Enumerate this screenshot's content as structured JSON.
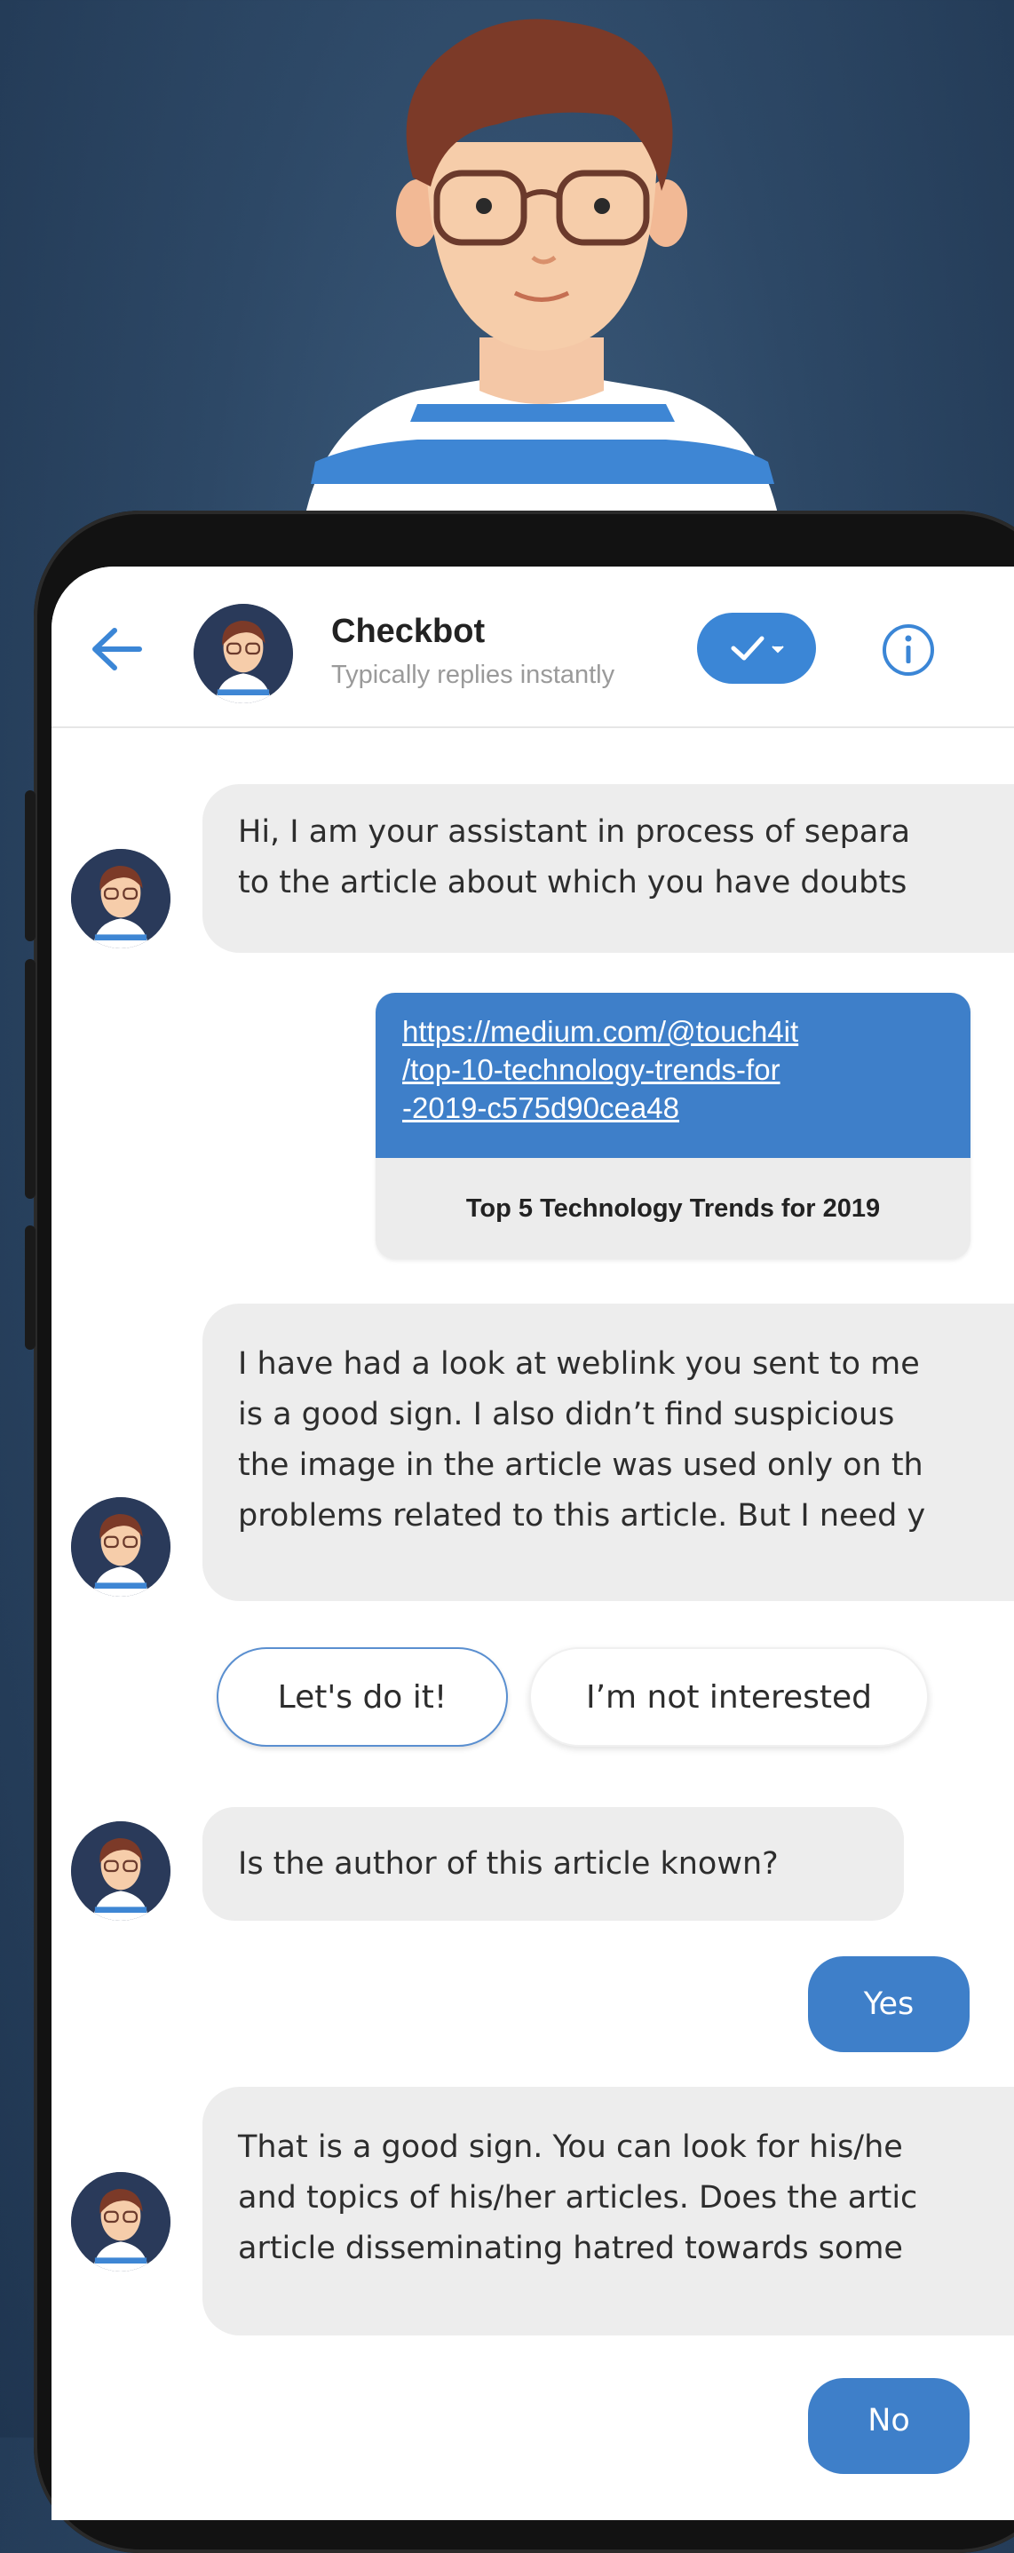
{
  "header": {
    "bot_name": "Checkbot",
    "bot_status": "Typically replies instantly"
  },
  "messages": {
    "greeting": [
      "Hi, I am your assistant in process of separa",
      "to the article about which you have doubts"
    ],
    "link_card": {
      "url_lines": [
        "https://medium.com/@touch4it",
        "/top-10-technology-trends-for",
        "-2019-c575d90cea48"
      ],
      "title": "Top 5 Technology Trends for 2019"
    },
    "analysis": [
      "I have had a look at weblink you sent to me",
      "is a good sign. I also didn’t find suspicious",
      "the image in the article was used only on th",
      "problems related to this article. But I need y"
    ],
    "question": "Is the author of this article known?",
    "reply_yes": "Yes",
    "followup": [
      "That is a good sign. You can look for his/he",
      "and topics of his/her articles. Does the artic",
      "article disseminating hatred towards some"
    ],
    "reply_no": "No"
  },
  "quick_replies": {
    "primary": "Let's do it!",
    "secondary": "I’m not interested"
  },
  "colors": {
    "accent": "#3e7fc9",
    "bubble": "#ededed",
    "background": "#2d4866"
  },
  "icons": {
    "back": "arrow-left-icon",
    "check": "check-dropdown-icon",
    "info": "info-icon"
  }
}
